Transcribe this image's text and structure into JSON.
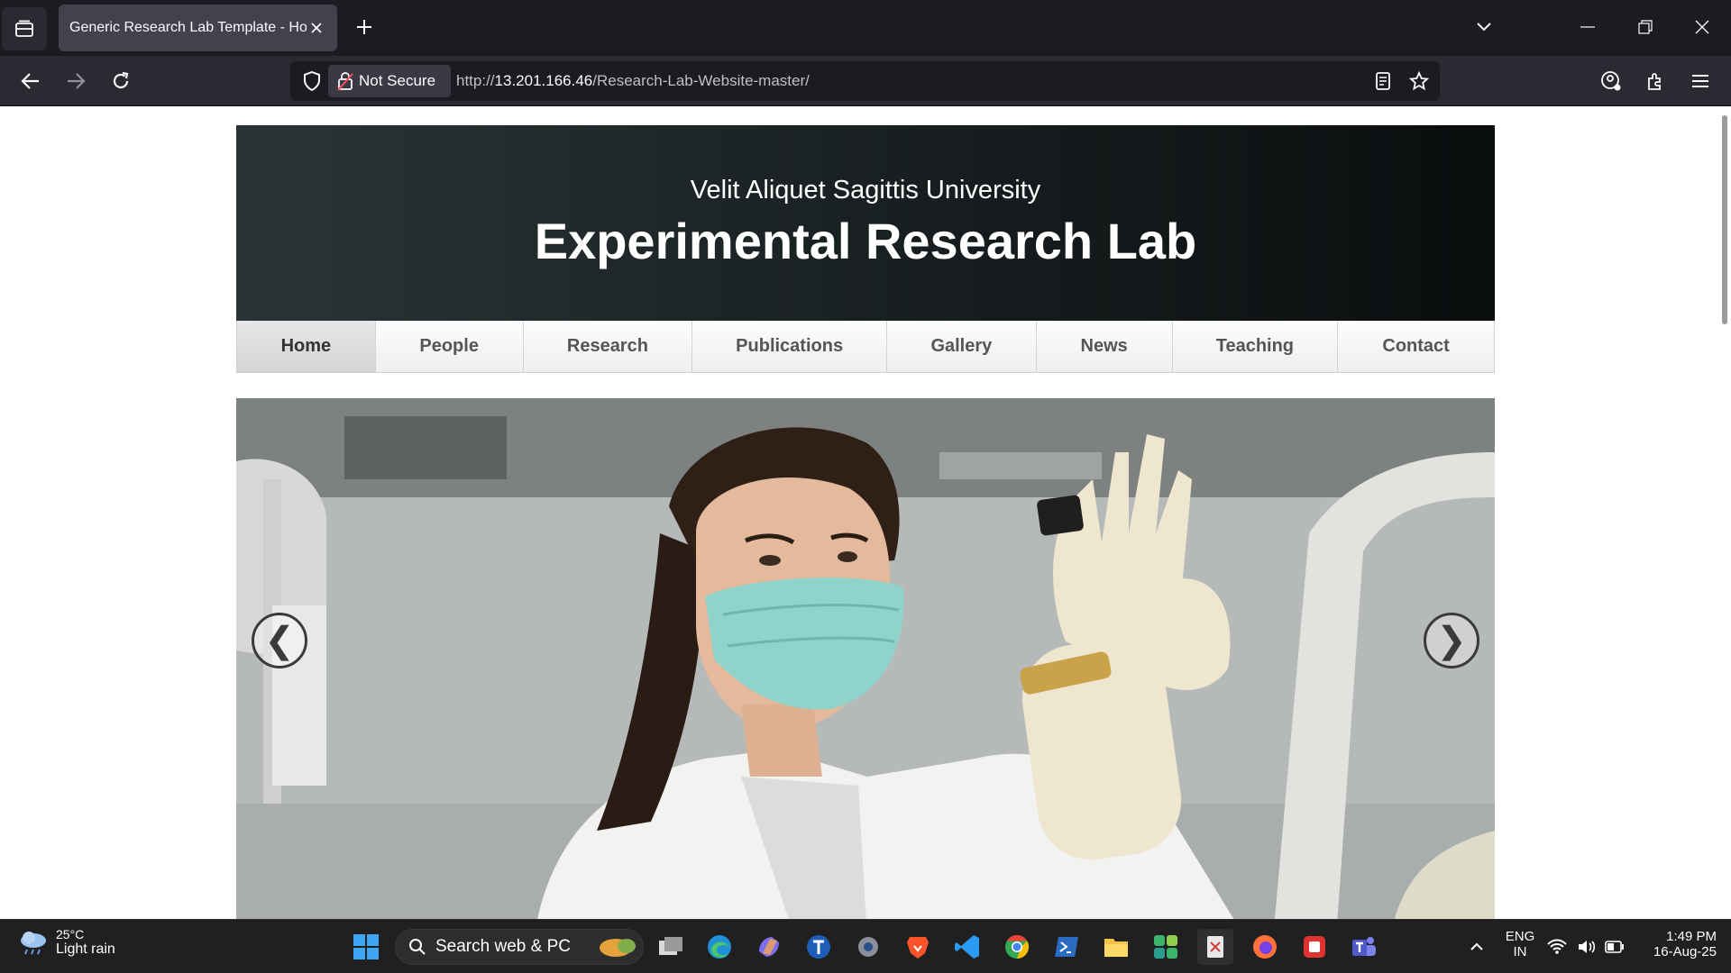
{
  "browser": {
    "tab_title": "Generic Research Lab Template - Home",
    "security_label": "Not Secure",
    "url_prefix": "http://",
    "url_host": "13.201.166.46",
    "url_path": "/Research-Lab-Website-master/"
  },
  "site": {
    "university": "Velit Aliquet Sagittis University",
    "lab_name": "Experimental Research Lab",
    "menu": [
      {
        "label": "Home",
        "active": true
      },
      {
        "label": "People",
        "active": false
      },
      {
        "label": "Research",
        "active": false
      },
      {
        "label": "Publications",
        "active": false
      },
      {
        "label": "Gallery",
        "active": false
      },
      {
        "label": "News",
        "active": false
      },
      {
        "label": "Teaching",
        "active": false
      },
      {
        "label": "Contact",
        "active": false
      }
    ],
    "carousel": {
      "prev_symbol": "❮",
      "next_symbol": "❯"
    }
  },
  "taskbar": {
    "weather_temp": "25°C",
    "weather_desc": "Light rain",
    "search_label": "Search web & PC",
    "lang_top": "ENG",
    "lang_bottom": "IN",
    "time": "1:49 PM",
    "date": "16-Aug-25"
  },
  "colors": {
    "accent_active_tab": "#42414d",
    "header_dark": "#1b2224"
  }
}
